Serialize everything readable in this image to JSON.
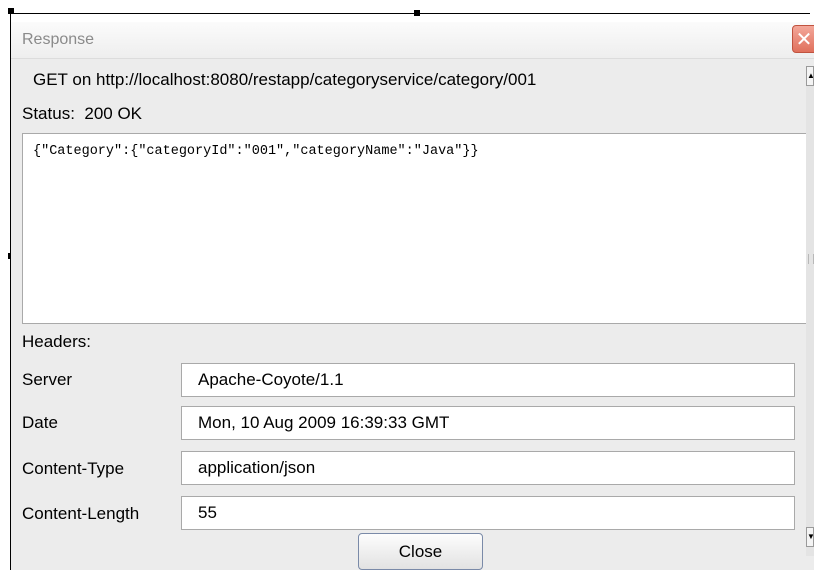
{
  "window": {
    "title": "Response",
    "close_glyph": "✕"
  },
  "request": {
    "line": "GET on http://localhost:8080/restapp/categoryservice/category/001"
  },
  "status": {
    "line": "Status:  200 OK"
  },
  "body": {
    "text": "{\"Category\":{\"categoryId\":\"001\",\"categoryName\":\"Java\"}}"
  },
  "headers": {
    "label": "Headers:",
    "rows": [
      {
        "name": "Server",
        "value": "Apache-Coyote/1.1"
      },
      {
        "name": "Date",
        "value": "Mon, 10 Aug 2009 16:39:33 GMT"
      },
      {
        "name": "Content-Type",
        "value": "application/json"
      },
      {
        "name": "Content-Length",
        "value": "55"
      }
    ]
  },
  "scrollbar": {
    "up_icon": "▲",
    "down_icon": "▼"
  },
  "footer": {
    "close_label": "Close"
  }
}
